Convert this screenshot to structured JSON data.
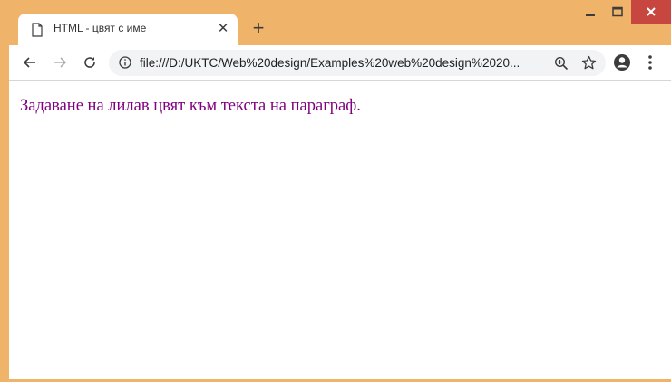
{
  "browser": {
    "tab": {
      "title": "HTML - цвят с име",
      "close_label": "✕"
    },
    "new_tab_label": "+",
    "address_bar": {
      "url": "file:///D:/UKTC/Web%20design/Examples%20web%20design%2020..."
    },
    "window_controls": {
      "minimize": "minimize",
      "maximize": "maximize",
      "close": "close"
    },
    "frame_color": "#f0b36a",
    "close_button_color": "#c7463f"
  },
  "page": {
    "paragraph": "Задаване на лилав цвят към текста на параграф.",
    "paragraph_color": "#800080"
  },
  "icons": {
    "tab": "page-icon",
    "back": "arrow-left-icon",
    "forward": "arrow-right-icon",
    "reload": "reload-icon",
    "info": "info-icon",
    "zoom": "zoom-icon",
    "bookmark": "star-icon",
    "profile": "account-icon",
    "menu": "kebab-menu-icon"
  }
}
